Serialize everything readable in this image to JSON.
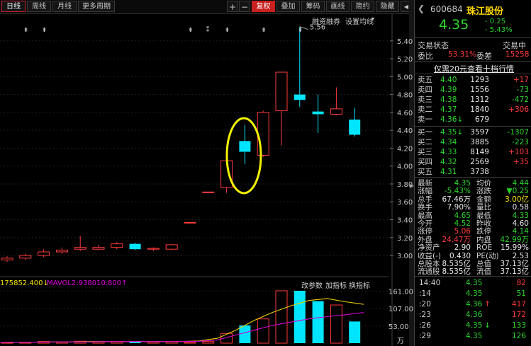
{
  "toolbar": {
    "tabs": [
      "日线",
      "周线",
      "月线",
      "更多周期"
    ],
    "plus": "+",
    "minus": "−",
    "right_buttons": [
      "复权",
      "叠加",
      "筹码",
      "画线",
      "简约",
      "隐藏"
    ],
    "scroll_left": "◀",
    "scroll_right": "▶"
  },
  "chart_header": {
    "links": [
      "融资融券",
      "设置均线"
    ],
    "markers": [
      "⇟",
      "⇟",
      "⇟",
      "⁑",
      "⇟",
      "⇟",
      "⇟"
    ]
  },
  "chart_data": {
    "type": "candlestick",
    "ylim": [
      2.85,
      5.62
    ],
    "yticks": [
      "5.40",
      "5.20",
      "5.00",
      "4.80",
      "4.60",
      "4.40",
      "4.20",
      "4.00",
      "3.80",
      "3.60",
      "3.40",
      "3.20",
      "3.00"
    ],
    "high_annotation": "5.56",
    "candles": [
      {
        "o": 2.95,
        "c": 2.97,
        "h": 2.99,
        "l": 2.93,
        "dir": "up"
      },
      {
        "o": 2.97,
        "c": 3.0,
        "h": 3.02,
        "l": 2.95,
        "dir": "up"
      },
      {
        "o": 3.0,
        "c": 3.04,
        "h": 3.07,
        "l": 2.98,
        "dir": "up"
      },
      {
        "o": 3.04,
        "c": 3.06,
        "h": 3.09,
        "l": 3.02,
        "dir": "up"
      },
      {
        "o": 3.07,
        "c": 3.09,
        "h": 3.22,
        "l": 3.05,
        "dir": "up"
      },
      {
        "o": 3.07,
        "c": 3.09,
        "h": 3.12,
        "l": 3.06,
        "dir": "up"
      },
      {
        "o": 3.09,
        "c": 3.13,
        "h": 3.15,
        "l": 3.07,
        "dir": "up"
      },
      {
        "o": 3.13,
        "c": 3.07,
        "h": 3.14,
        "l": 3.06,
        "dir": "down"
      },
      {
        "o": 3.07,
        "c": 3.08,
        "h": 3.09,
        "l": 3.05,
        "dir": "up"
      },
      {
        "o": 3.07,
        "c": 3.12,
        "h": 3.13,
        "l": 3.06,
        "dir": "up"
      },
      {
        "o": 3.37,
        "c": 3.37,
        "h": 3.37,
        "l": 3.37,
        "dir": "up"
      },
      {
        "o": 3.71,
        "c": 3.71,
        "h": 3.71,
        "l": 3.71,
        "dir": "up"
      },
      {
        "o": 3.76,
        "c": 4.06,
        "h": 4.06,
        "l": 3.7,
        "dir": "up"
      },
      {
        "o": 4.28,
        "c": 4.16,
        "h": 4.46,
        "l": 4.02,
        "dir": "down"
      },
      {
        "o": 4.12,
        "c": 4.6,
        "h": 4.62,
        "l": 4.1,
        "dir": "up"
      },
      {
        "o": 4.62,
        "c": 5.05,
        "h": 5.05,
        "l": 4.23,
        "dir": "up"
      },
      {
        "o": 4.8,
        "c": 4.74,
        "h": 5.56,
        "l": 4.66,
        "dir": "down"
      },
      {
        "o": 4.61,
        "c": 4.58,
        "h": 4.8,
        "l": 4.37,
        "dir": "down"
      },
      {
        "o": 4.58,
        "c": 4.64,
        "h": 4.88,
        "l": 4.57,
        "dir": "up"
      },
      {
        "o": 4.52,
        "c": 4.35,
        "h": 4.65,
        "l": 4.33,
        "dir": "down"
      }
    ],
    "volume": {
      "label1": "175852.400↓",
      "label2": "MAVOL2:938010.800↑",
      "links": [
        "改参数",
        "加指标",
        "换指标"
      ],
      "yticks": [
        "161.00",
        "107.00",
        "53.00",
        "万"
      ],
      "ylim": [
        0,
        175
      ],
      "bars": [
        2,
        3,
        5,
        4,
        6,
        4,
        5,
        5,
        4,
        5,
        3,
        5,
        30,
        55,
        75,
        162,
        162,
        130,
        118,
        67
      ],
      "dirs": [
        "up",
        "up",
        "up",
        "up",
        "up",
        "up",
        "up",
        "down",
        "up",
        "up",
        "up",
        "up",
        "up",
        "down",
        "up",
        "up",
        "down",
        "down",
        "up",
        "down"
      ],
      "ma1": [
        2,
        3,
        3,
        4,
        4,
        5,
        5,
        5,
        5,
        5,
        5,
        7,
        15,
        40,
        70,
        95,
        115,
        132,
        138,
        128,
        120
      ],
      "ma2": [
        2,
        3,
        3,
        4,
        4,
        4,
        5,
        5,
        5,
        5,
        5,
        6,
        10,
        25,
        40,
        55,
        65,
        75,
        82,
        88,
        95
      ]
    }
  },
  "quote": {
    "code": "600684",
    "name": "珠江股份",
    "price": "4.35",
    "change": "- 0.25",
    "change_pct": "- 5.43%",
    "status_label": "交易状态",
    "status_value": "交易中",
    "weibi_label": "委比",
    "weibi_value": "53.31%",
    "weicha_label": "委差",
    "weicha_value": "15258",
    "promo": "仅需20元查看十档行情",
    "asks": [
      {
        "label": "卖五",
        "price": "4.40",
        "vol": "1293",
        "chg": "+17",
        "chgc": "red"
      },
      {
        "label": "卖四",
        "price": "4.39",
        "vol": "1556",
        "chg": "-73",
        "chgc": "green"
      },
      {
        "label": "卖三",
        "price": "4.38",
        "vol": "1312",
        "chg": "-472",
        "chgc": "green"
      },
      {
        "label": "卖二",
        "price": "4.37",
        "vol": "1840",
        "chg": "+306",
        "chgc": "red"
      },
      {
        "label": "卖一",
        "price": "4.36↓",
        "vol": "679",
        "chg": "",
        "chgc": "red"
      }
    ],
    "bids": [
      {
        "label": "买一",
        "price": "4.35↓",
        "vol": "3597",
        "chg": "-1307",
        "chgc": "green"
      },
      {
        "label": "买二",
        "price": "4.34",
        "vol": "3885",
        "chg": "-223",
        "chgc": "green"
      },
      {
        "label": "买三",
        "price": "4.33",
        "vol": "8149",
        "chg": "+103",
        "chgc": "red"
      },
      {
        "label": "买四",
        "price": "4.32",
        "vol": "2569",
        "chg": "+35",
        "chgc": "red"
      },
      {
        "label": "买五",
        "price": "4.31",
        "vol": "3738",
        "chg": "",
        "chgc": "red"
      }
    ],
    "stats": [
      {
        "l1": "最新",
        "v1": "4.35",
        "c1": "green",
        "l2": "均价",
        "v2": "4.44",
        "c2": "green"
      },
      {
        "l1": "涨幅",
        "v1": "-5.43%",
        "c1": "green",
        "l2": "涨跌",
        "v2": "▼0.25",
        "c2": "green"
      },
      {
        "l1": "总手",
        "v1": "67.46万",
        "c1": "white",
        "l2": "金额",
        "v2": "3.00亿",
        "c2": "yellow"
      },
      {
        "l1": "换手",
        "v1": "7.90%",
        "c1": "white",
        "l2": "量比",
        "v2": "0.58",
        "c2": "white"
      },
      {
        "l1": "最高",
        "v1": "4.65",
        "c1": "green",
        "l2": "最低",
        "v2": "4.33",
        "c2": "green"
      },
      {
        "l1": "今开",
        "v1": "4.52",
        "c1": "green",
        "l2": "昨收",
        "v2": "4.60",
        "c2": "white"
      },
      {
        "l1": "涨停",
        "v1": "5.06",
        "c1": "red",
        "l2": "跌停",
        "v2": "4.14",
        "c2": "green"
      },
      {
        "l1": "外盘",
        "v1": "24.47万",
        "c1": "red",
        "l2": "内盘",
        "v2": "42.99万",
        "c2": "green"
      },
      {
        "l1": "净资产",
        "v1": "2.90",
        "c1": "white",
        "l2": "ROE",
        "v2": "15.99%",
        "c2": "white"
      },
      {
        "l1": "收益(-)",
        "v1": "0.430",
        "c1": "white",
        "l2": "PE(动)",
        "v2": "2.53",
        "c2": "white"
      },
      {
        "l1": "总股本",
        "v1": "8.535亿",
        "c1": "white",
        "l2": "总值",
        "v2": "37.13亿",
        "c2": "white"
      },
      {
        "l1": "流通股",
        "v1": "8.535亿",
        "c1": "white",
        "l2": "流值",
        "v2": "37.13亿",
        "c2": "white"
      }
    ],
    "ticks": [
      {
        "time": "14:40",
        "price": "4.35",
        "vol": "82",
        "vc": "red",
        "arrow": ""
      },
      {
        "time": ":14",
        "price": "4.35",
        "vol": "51",
        "vc": "green",
        "arrow": ""
      },
      {
        "time": ":20",
        "price": "4.36",
        "vol": "417",
        "vc": "red",
        "arrow": "↑"
      },
      {
        "time": ":23",
        "price": "4.36",
        "vol": "172",
        "vc": "red",
        "arrow": ""
      },
      {
        "time": ":26",
        "price": "4.35",
        "vol": "133",
        "vc": "green",
        "arrow": "↓"
      },
      {
        "time": ":29",
        "price": "4.35",
        "vol": "126",
        "vc": "green",
        "arrow": ""
      }
    ]
  },
  "colors": {
    "up": "#ff3b3b",
    "down": "#00e5ff",
    "ma1": "#e8d000",
    "ma2": "#d000d0",
    "highlight": "#f2f200"
  }
}
